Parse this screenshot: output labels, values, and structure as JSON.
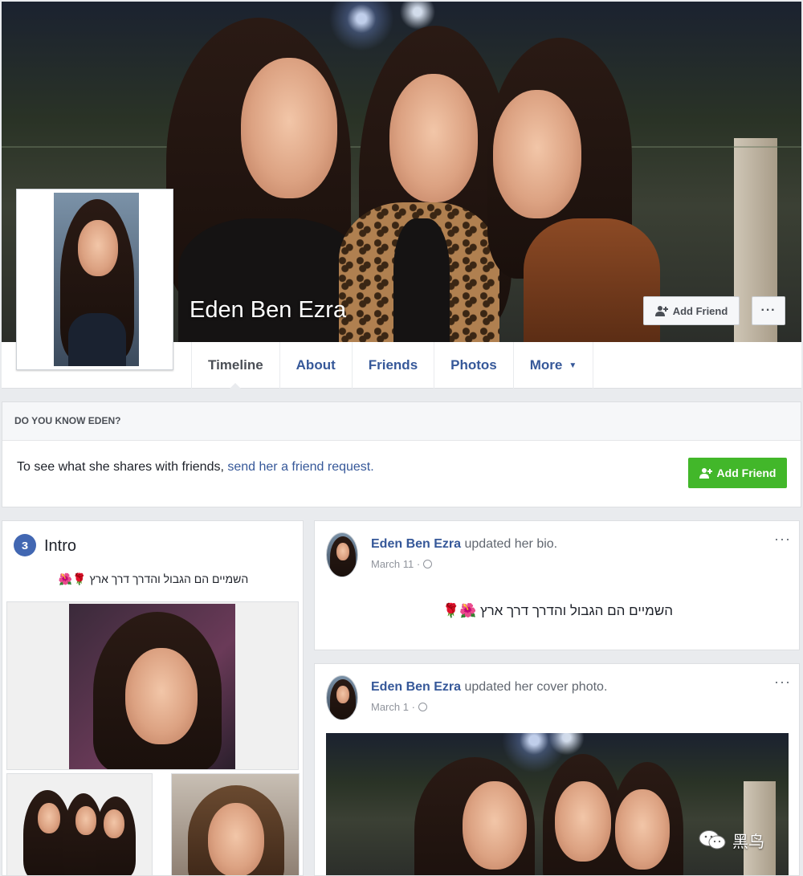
{
  "profile": {
    "name": "Eden Ben Ezra",
    "add_friend_label": "Add Friend",
    "more_label": "···"
  },
  "nav": {
    "tabs": [
      {
        "label": "Timeline",
        "active": true
      },
      {
        "label": "About"
      },
      {
        "label": "Friends"
      },
      {
        "label": "Photos"
      },
      {
        "label": "More"
      }
    ],
    "more_caret": "▼"
  },
  "know": {
    "heading": "DO YOU KNOW EDEN?",
    "text": "To see what she shares with friends, ",
    "link": "send her a friend request.",
    "button_label": "Add Friend"
  },
  "intro": {
    "icon_glyph": "з",
    "title": "Intro",
    "bio": "השמיים הם הגבול והדרך דרך ארץ",
    "bio_emoji": "🌹🌺"
  },
  "posts": [
    {
      "author": "Eden Ben Ezra",
      "action": " updated her bio.",
      "date": "March 11 ·",
      "options": "···",
      "body": "השמיים הם הגבול והדרך דרך ארץ",
      "body_emoji": "🌺🌹"
    },
    {
      "author": "Eden Ben Ezra",
      "action": " updated her cover photo.",
      "date": "March 1 ·",
      "options": "···"
    }
  ],
  "watermark": {
    "text": "黑鸟"
  },
  "colors": {
    "link": "#365899",
    "accent_green": "#42b72a",
    "page_bg": "#e9ebee",
    "brand_blue": "#4267b2"
  },
  "icons": {
    "add_friend": "add-friend-icon",
    "globe": "globe-icon",
    "intro": "intro-icon",
    "wechat": "wechat-icon"
  }
}
